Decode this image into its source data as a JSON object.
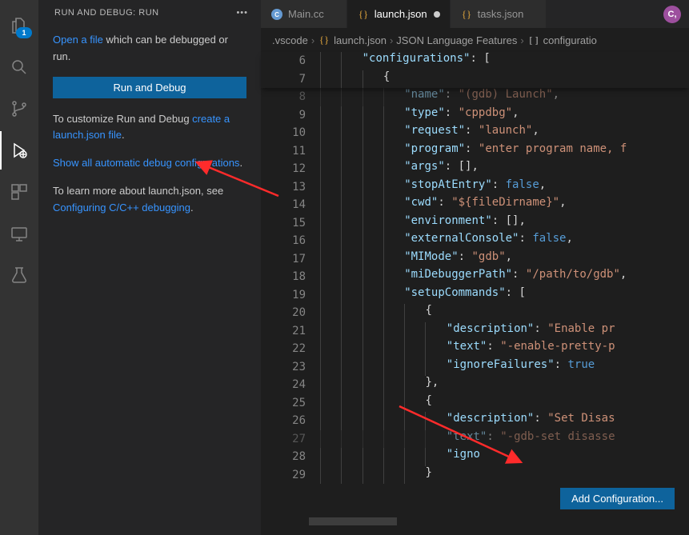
{
  "sidebar": {
    "title": "RUN AND DEBUG: RUN",
    "p1_pre": "",
    "open_file_link": "Open a file",
    "p1_post": " which can be debugged or run.",
    "primary_button": "Run and Debug",
    "p2_pre": "To customize Run and Debug ",
    "create_launch_link": "create a launch.json file",
    "p2_post": ".",
    "show_all_link": "Show all automatic debug configurations",
    "show_all_post": ".",
    "p3_pre": "To learn more about launch.json, see ",
    "configuring_link": "Configuring C/C++ debugging",
    "p3_post": "."
  },
  "activity_badge": "1",
  "tabs": [
    {
      "icon": "cpp",
      "label": "Main.cc",
      "active": false,
      "dirty": false
    },
    {
      "icon": "json",
      "label": "launch.json",
      "active": true,
      "dirty": true
    },
    {
      "icon": "json",
      "label": "tasks.json",
      "active": false,
      "dirty": false
    }
  ],
  "tab_action_label": "C,",
  "breadcrumb": [
    {
      "icon": null,
      "text": ".vscode"
    },
    {
      "icon": "json",
      "text": "launch.json"
    },
    {
      "icon": null,
      "text": "JSON Language Features"
    },
    {
      "icon": "array",
      "text": "configuratio"
    }
  ],
  "sticky": [
    {
      "ln": 6,
      "indent": 2,
      "frags": [
        [
          "key",
          "\"configurations\""
        ],
        [
          "p",
          ": "
        ],
        [
          "p",
          "["
        ]
      ]
    },
    {
      "ln": 7,
      "indent": 3,
      "frags": [
        [
          "p",
          "{"
        ]
      ]
    }
  ],
  "code": [
    {
      "ln": 8,
      "indent": 4,
      "frags": [
        [
          "key",
          "\"name\""
        ],
        [
          "p",
          ": "
        ],
        [
          "str",
          "\"(gdb) Launch\""
        ],
        [
          "p",
          ","
        ]
      ],
      "dim": true
    },
    {
      "ln": 9,
      "indent": 4,
      "frags": [
        [
          "key",
          "\"type\""
        ],
        [
          "p",
          ": "
        ],
        [
          "str",
          "\"cppdbg\""
        ],
        [
          "p",
          ","
        ]
      ]
    },
    {
      "ln": 10,
      "indent": 4,
      "frags": [
        [
          "key",
          "\"request\""
        ],
        [
          "p",
          ": "
        ],
        [
          "str",
          "\"launch\""
        ],
        [
          "p",
          ","
        ]
      ]
    },
    {
      "ln": 11,
      "indent": 4,
      "frags": [
        [
          "key",
          "\"program\""
        ],
        [
          "p",
          ": "
        ],
        [
          "str",
          "\"enter program name, f"
        ]
      ]
    },
    {
      "ln": 12,
      "indent": 4,
      "frags": [
        [
          "key",
          "\"args\""
        ],
        [
          "p",
          ": []"
        ],
        [
          "p",
          ","
        ]
      ]
    },
    {
      "ln": 13,
      "indent": 4,
      "frags": [
        [
          "key",
          "\"stopAtEntry\""
        ],
        [
          "p",
          ": "
        ],
        [
          "kw",
          "false"
        ],
        [
          "p",
          ","
        ]
      ]
    },
    {
      "ln": 14,
      "indent": 4,
      "frags": [
        [
          "key",
          "\"cwd\""
        ],
        [
          "p",
          ": "
        ],
        [
          "str",
          "\"${fileDirname}\""
        ],
        [
          "p",
          ","
        ]
      ]
    },
    {
      "ln": 15,
      "indent": 4,
      "frags": [
        [
          "key",
          "\"environment\""
        ],
        [
          "p",
          ": []"
        ],
        [
          "p",
          ","
        ]
      ]
    },
    {
      "ln": 16,
      "indent": 4,
      "frags": [
        [
          "key",
          "\"externalConsole\""
        ],
        [
          "p",
          ": "
        ],
        [
          "kw",
          "false"
        ],
        [
          "p",
          ","
        ]
      ]
    },
    {
      "ln": 17,
      "indent": 4,
      "frags": [
        [
          "key",
          "\"MIMode\""
        ],
        [
          "p",
          ": "
        ],
        [
          "str",
          "\"gdb\""
        ],
        [
          "p",
          ","
        ]
      ]
    },
    {
      "ln": 18,
      "indent": 4,
      "frags": [
        [
          "key",
          "\"miDebuggerPath\""
        ],
        [
          "p",
          ": "
        ],
        [
          "str",
          "\"/path/to/gdb\""
        ],
        [
          "p",
          ","
        ]
      ]
    },
    {
      "ln": 19,
      "indent": 4,
      "frags": [
        [
          "key",
          "\"setupCommands\""
        ],
        [
          "p",
          ": ["
        ]
      ]
    },
    {
      "ln": 20,
      "indent": 5,
      "frags": [
        [
          "p",
          "{"
        ]
      ]
    },
    {
      "ln": 21,
      "indent": 6,
      "frags": [
        [
          "key",
          "\"description\""
        ],
        [
          "p",
          ": "
        ],
        [
          "str",
          "\"Enable pr"
        ]
      ]
    },
    {
      "ln": 22,
      "indent": 6,
      "frags": [
        [
          "key",
          "\"text\""
        ],
        [
          "p",
          ": "
        ],
        [
          "str",
          "\"-enable-pretty-p"
        ]
      ]
    },
    {
      "ln": 23,
      "indent": 6,
      "frags": [
        [
          "key",
          "\"ignoreFailures\""
        ],
        [
          "p",
          ": "
        ],
        [
          "kw",
          "true"
        ]
      ]
    },
    {
      "ln": 24,
      "indent": 5,
      "frags": [
        [
          "p",
          "},"
        ]
      ]
    },
    {
      "ln": 25,
      "indent": 5,
      "frags": [
        [
          "p",
          "{"
        ]
      ]
    },
    {
      "ln": 26,
      "indent": 6,
      "frags": [
        [
          "key",
          "\"description\""
        ],
        [
          "p",
          ": "
        ],
        [
          "str",
          "\"Set Disas"
        ]
      ]
    },
    {
      "ln": 27,
      "indent": 6,
      "frags": [
        [
          "key",
          "\"text\""
        ],
        [
          "p",
          ": "
        ],
        [
          "str",
          "\"-gdb-set disasse"
        ]
      ],
      "dim": true
    },
    {
      "ln": 28,
      "indent": 6,
      "frags": [
        [
          "key",
          "\"igno"
        ]
      ]
    },
    {
      "ln": 29,
      "indent": 5,
      "frags": [
        [
          "p",
          "}"
        ]
      ]
    }
  ],
  "add_conf_label": "Add Configuration..."
}
